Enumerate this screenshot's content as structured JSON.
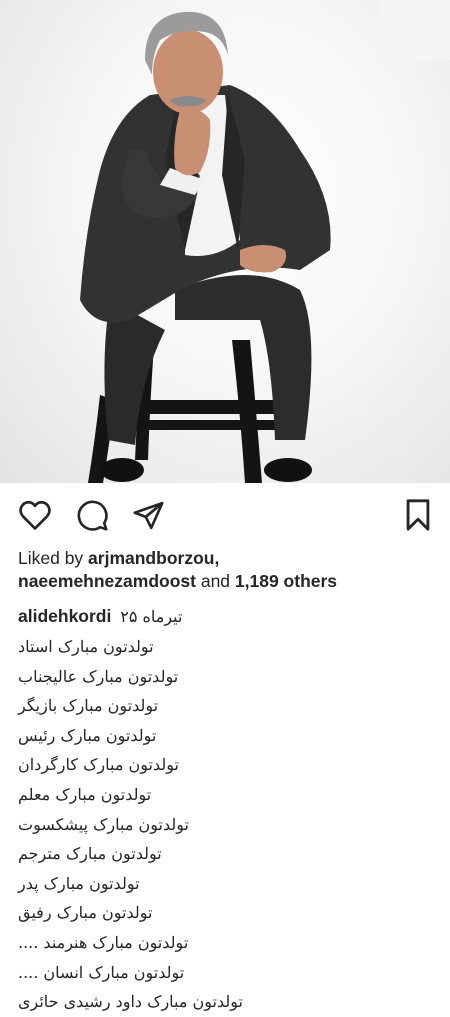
{
  "post": {
    "image_description_icon": "portrait-photo"
  },
  "actions": {
    "like_icon": "heart-icon",
    "comment_icon": "comment-icon",
    "share_icon": "paper-plane-icon",
    "save_icon": "bookmark-icon"
  },
  "likes": {
    "prefix": "Liked by ",
    "user1": "arjmandborzou,",
    "user2": "naeemehnezamdoost",
    "middle": " and ",
    "count": "1,189 others"
  },
  "caption": {
    "username": "alidehkordi",
    "date": "۲۵ تیرماه",
    "lines": [
      "تولدتون مبارک استاد",
      "تولدتون مبارک عالیجناب",
      "تولدتون مبارک بازیگر",
      "تولدتون مبارک رئیس",
      "تولدتون مبارک کارگردان",
      "تولدتون مبارک معلم",
      "تولدتون مبارک پیشکسوت",
      "تولدتون مبارک مترجم",
      "تولدتون مبارک پدر",
      "تولدتون مبارک رفیق",
      "تولدتون مبارک هنرمند ....",
      "تولدتون مبارک انسان ....",
      "تولدتون مبارک داود رشیدی حائری"
    ]
  },
  "colors": {
    "text": "#262626",
    "icon": "#262626",
    "background": "#ffffff"
  }
}
